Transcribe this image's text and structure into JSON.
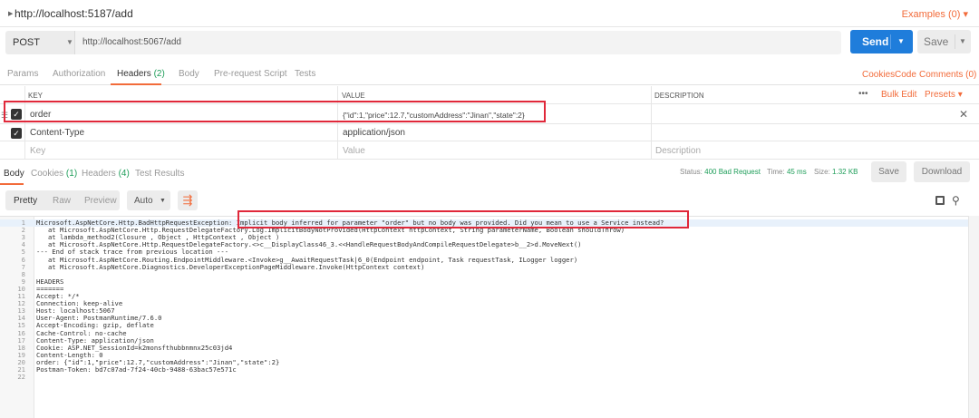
{
  "tab": {
    "title": "http://localhost:5187/add",
    "examples": "Examples (0)"
  },
  "request": {
    "method": "POST",
    "url": "http://localhost:5067/add",
    "send_label": "Send",
    "save_label": "Save"
  },
  "request_tabs": [
    {
      "label": "Params",
      "count": ""
    },
    {
      "label": "Authorization",
      "count": ""
    },
    {
      "label": "Headers",
      "count": "(2)"
    },
    {
      "label": "Body",
      "count": ""
    },
    {
      "label": "Pre-request Script",
      "count": ""
    },
    {
      "label": "Tests",
      "count": ""
    }
  ],
  "request_links": {
    "cookies": "Cookies",
    "code": "Code",
    "comments": "Comments (0)"
  },
  "headers_table": {
    "columns": {
      "key": "KEY",
      "value": "VALUE",
      "description": "DESCRIPTION"
    },
    "more": "•••",
    "bulk_edit": "Bulk Edit",
    "presets": "Presets",
    "rows": [
      {
        "key": "order",
        "value": "{\"id\":1,\"price\":12.7,\"customAddress\":\"Jinan\",\"state\":2}"
      },
      {
        "key": "Content-Type",
        "value": "application/json"
      }
    ],
    "placeholder": {
      "key": "Key",
      "value": "Value",
      "description": "Description"
    }
  },
  "response_tabs": [
    {
      "label": "Body",
      "count": ""
    },
    {
      "label": "Cookies",
      "count": "(1)"
    },
    {
      "label": "Headers",
      "count": "(4)"
    },
    {
      "label": "Test Results",
      "count": ""
    }
  ],
  "status": {
    "status_label": "Status:",
    "status": "400 Bad Request",
    "time_label": "Time:",
    "time": "45 ms",
    "size_label": "Size:",
    "size": "1.32 KB"
  },
  "response_actions": {
    "save": "Save",
    "download": "Download"
  },
  "view_modes": {
    "pretty": "Pretty",
    "raw": "Raw",
    "preview": "Preview",
    "format": "Auto"
  },
  "response_lines": [
    {
      "n": "1",
      "text": "Microsoft.AspNetCore.Http.BadHttpRequestException: Implicit body inferred for parameter \"order\" but no body was provided. Did you mean to use a Service instead?"
    },
    {
      "n": "2",
      "text": "   at Microsoft.AspNetCore.Http.RequestDelegateFactory.Log.ImplicitBodyNotProvided(HttpContext httpContext, String parameterName, Boolean shouldThrow)"
    },
    {
      "n": "3",
      "text": "   at lambda_method2(Closure , Object , HttpContext , Object )"
    },
    {
      "n": "4",
      "text": "   at Microsoft.AspNetCore.Http.RequestDelegateFactory.<>c__DisplayClass46_3.<<HandleRequestBodyAndCompileRequestDelegate>b__2>d.MoveNext()"
    },
    {
      "n": "5",
      "text": "--- End of stack trace from previous location ---"
    },
    {
      "n": "6",
      "text": "   at Microsoft.AspNetCore.Routing.EndpointMiddleware.<Invoke>g__AwaitRequestTask|6_0(Endpoint endpoint, Task requestTask, ILogger logger)"
    },
    {
      "n": "7",
      "text": "   at Microsoft.AspNetCore.Diagnostics.DeveloperExceptionPageMiddleware.Invoke(HttpContext context)"
    },
    {
      "n": "8",
      "text": ""
    },
    {
      "n": "9",
      "text": "HEADERS"
    },
    {
      "n": "10",
      "text": "======="
    },
    {
      "n": "11",
      "text": "Accept: */*"
    },
    {
      "n": "12",
      "text": "Connection: keep-alive"
    },
    {
      "n": "13",
      "text": "Host: localhost:5067"
    },
    {
      "n": "14",
      "text": "User-Agent: PostmanRuntime/7.6.0"
    },
    {
      "n": "15",
      "text": "Accept-Encoding: gzip, deflate"
    },
    {
      "n": "16",
      "text": "Cache-Control: no-cache"
    },
    {
      "n": "17",
      "text": "Content-Type: application/json"
    },
    {
      "n": "18",
      "text": "Cookie: ASP.NET_SessionId=k2monsfthubbnmnx25c03jd4"
    },
    {
      "n": "19",
      "text": "Content-Length: 0"
    },
    {
      "n": "20",
      "text": "order: {\"id\":1,\"price\":12.7,\"customAddress\":\"Jinan\",\"state\":2}"
    },
    {
      "n": "21",
      "text": "Postman-Token: bd7c07ad-7f24-40cb-9488-63bac57e571c"
    },
    {
      "n": "22",
      "text": ""
    }
  ],
  "colors": {
    "accent": "#f26b3a",
    "send": "#1f7ddb",
    "ok_green": "#1f9e5a",
    "highlight": "#e0283a"
  }
}
